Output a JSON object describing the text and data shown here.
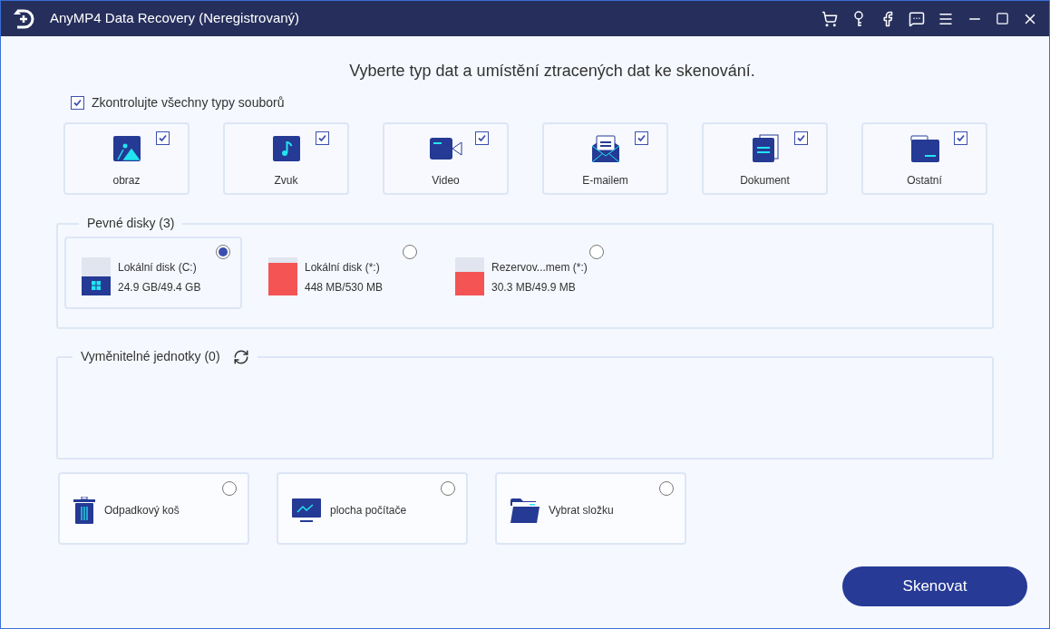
{
  "window": {
    "title": "AnyMP4 Data Recovery (Neregistrovaný)"
  },
  "heading": "Vyberte typ dat a umístění ztracených dat ke skenování.",
  "check_all": {
    "label": "Zkontrolujte všechny typy souborů",
    "checked": true
  },
  "file_types": [
    {
      "kind": "image",
      "label": "obraz",
      "checked": true
    },
    {
      "kind": "audio",
      "label": "Zvuk",
      "checked": true
    },
    {
      "kind": "video",
      "label": "Video",
      "checked": true
    },
    {
      "kind": "email",
      "label": "E-mailem",
      "checked": true
    },
    {
      "kind": "document",
      "label": "Dokument",
      "checked": true
    },
    {
      "kind": "other",
      "label": "Ostatní",
      "checked": true
    }
  ],
  "hard_disks": {
    "title": "Pevné disky (3)",
    "disks": [
      {
        "kind": "system",
        "name": "Lokální disk (C:)",
        "size": "24.9 GB/49.4 GB",
        "level": 0.5,
        "color": "#253a94",
        "selected": true
      },
      {
        "kind": "plain",
        "name": "Lokální disk (*:)",
        "size": "448 MB/530 MB",
        "level": 0.85,
        "color": "#f45454",
        "selected": false
      },
      {
        "kind": "plain",
        "name": "Rezervov...mem (*:)",
        "size": "30.3 MB/49.9 MB",
        "level": 0.6,
        "color": "#f45454",
        "selected": false
      }
    ]
  },
  "removable": {
    "title": "Vyměnitelné jednotky (0)"
  },
  "locations": [
    {
      "kind": "trash",
      "label": "Odpadkový koš",
      "selected": false
    },
    {
      "kind": "desktop",
      "label": "plocha počítače",
      "selected": false
    },
    {
      "kind": "folder",
      "label": "Vybrat složku",
      "selected": false
    }
  ],
  "scan_button": "Skenovat"
}
